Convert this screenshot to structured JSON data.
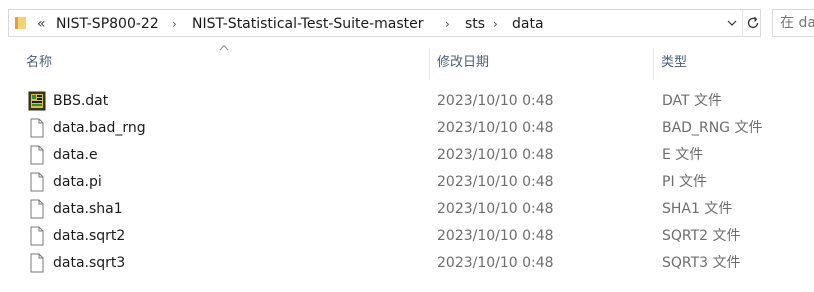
{
  "address_bar": {
    "overflow": "«",
    "breadcrumbs": [
      {
        "label": "NIST-SP800-22"
      },
      {
        "label": "NIST-Statistical-Test-Suite-master"
      },
      {
        "label": "sts"
      },
      {
        "label": "data"
      }
    ]
  },
  "search": {
    "placeholder": "在 da"
  },
  "columns": {
    "name": "名称",
    "date_modified": "修改日期",
    "type": "类型"
  },
  "files": [
    {
      "name": "BBS.dat",
      "date": "2023/10/10 0:48",
      "type": "DAT 文件",
      "icon": "dat-file-icon"
    },
    {
      "name": "data.bad_rng",
      "date": "2023/10/10 0:48",
      "type": "BAD_RNG 文件",
      "icon": "blank-file-icon"
    },
    {
      "name": "data.e",
      "date": "2023/10/10 0:48",
      "type": "E 文件",
      "icon": "blank-file-icon"
    },
    {
      "name": "data.pi",
      "date": "2023/10/10 0:48",
      "type": "PI 文件",
      "icon": "blank-file-icon"
    },
    {
      "name": "data.sha1",
      "date": "2023/10/10 0:48",
      "type": "SHA1 文件",
      "icon": "blank-file-icon"
    },
    {
      "name": "data.sqrt2",
      "date": "2023/10/10 0:48",
      "type": "SQRT2 文件",
      "icon": "blank-file-icon"
    },
    {
      "name": "data.sqrt3",
      "date": "2023/10/10 0:48",
      "type": "SQRT3 文件",
      "icon": "blank-file-icon"
    }
  ],
  "colors": {
    "folder_yellow": "#e8b84a",
    "header_text": "#4c607a",
    "secondary_text": "#6d6d6d",
    "border": "#d9d9d9"
  }
}
